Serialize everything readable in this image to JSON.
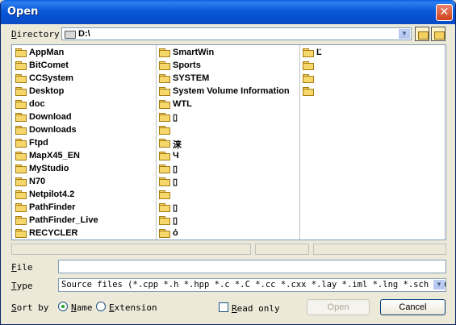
{
  "window": {
    "title": "Open",
    "close_label": "✕"
  },
  "directory": {
    "label_underlined": "D",
    "label_rest": "irectory",
    "value": "D:\\"
  },
  "files": {
    "col1": [
      "AppMan",
      "BitComet",
      "CCSystem",
      "Desktop",
      "doc",
      "Download",
      "Downloads",
      "Ftpd",
      "MapX45_EN",
      "MyStudio",
      "N70",
      "Netpilot4.2",
      "PathFinder",
      "PathFinder_Live",
      "RECYCLER"
    ],
    "col2": [
      "SmartWin",
      "Sports",
      "SYSTEM",
      "System Volume Information",
      "WTL",
      "      ▯",
      "",
      "      涞",
      "        Ч",
      "        ▯",
      "        ▯",
      "",
      "        ▯",
      "▯",
      "ό"
    ],
    "col3": [
      "          Ľ",
      "",
      "",
      ""
    ]
  },
  "file_field": {
    "label_underlined": "F",
    "label_rest": "ile",
    "value": ""
  },
  "type_field": {
    "label_underlined": "T",
    "label_rest": "ype",
    "value": "Source files (*.cpp *.h *.hpp *.c *.C *.cc *.cxx *.lay *.iml *.lng *.sch *.usr"
  },
  "sort": {
    "label_underlined": "S",
    "label_rest": "ort by",
    "name_underlined": "N",
    "name_rest": "ame",
    "ext_underlined": "E",
    "ext_rest": "xtension",
    "selected": "Name"
  },
  "read_only": {
    "label_underlined": "R",
    "label_rest": "ead only",
    "checked": false
  },
  "buttons": {
    "open": "Open",
    "cancel": "Cancel"
  },
  "icons": {
    "folder": "folder-icon",
    "drive": "drive-icon",
    "up": "up-folder-icon",
    "new": "new-folder-icon"
  }
}
